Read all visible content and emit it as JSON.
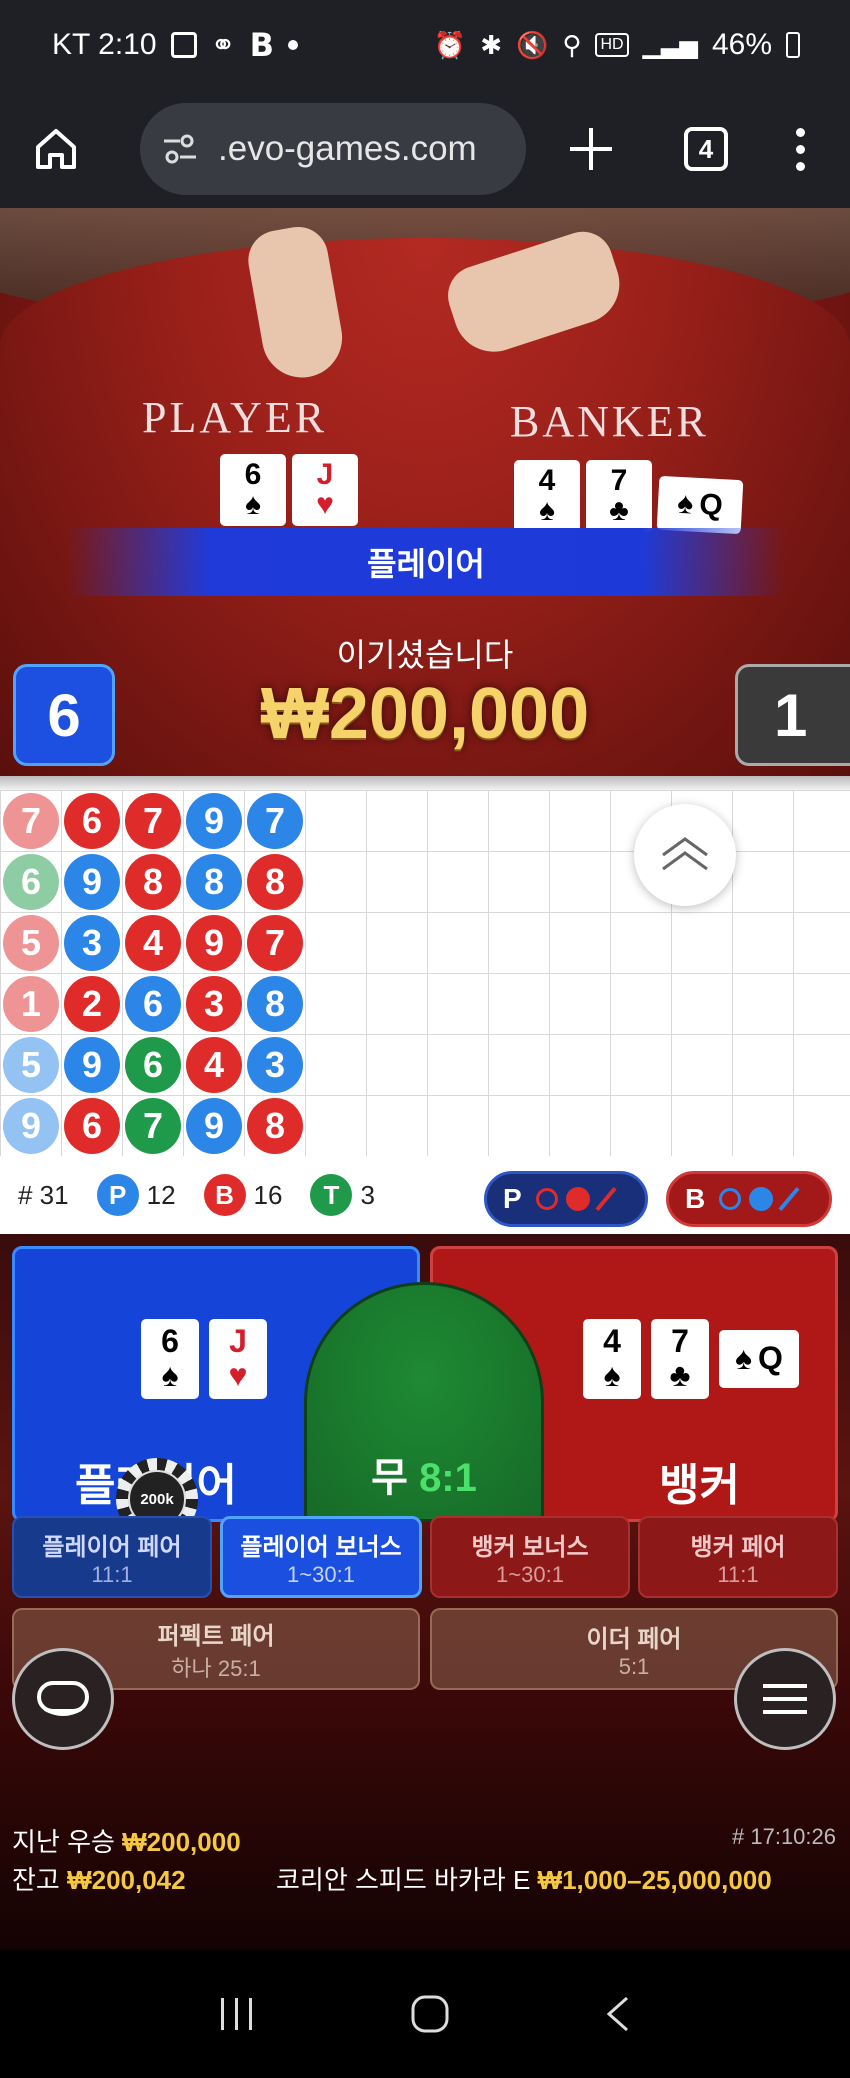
{
  "status_bar": {
    "carrier_time": "KT 2:10",
    "battery": "46%"
  },
  "browser": {
    "url": ".evo-games.com",
    "tab_count": "4"
  },
  "video": {
    "player_label": "PLAYER",
    "banker_label": "BANKER",
    "player_cards": [
      {
        "rank": "6",
        "suit": "♠",
        "color": "black"
      },
      {
        "rank": "J",
        "suit": "♥",
        "color": "red"
      }
    ],
    "banker_cards": [
      {
        "rank": "4",
        "suit": "♠",
        "color": "black"
      },
      {
        "rank": "7",
        "suit": "♣",
        "color": "black"
      },
      {
        "rank": "Q",
        "suit": "♠",
        "color": "black"
      }
    ],
    "winner_banner": "플레이어",
    "win_message": "이기셨습니다",
    "win_amount": "₩200,000",
    "player_score": "6",
    "banker_score": "1"
  },
  "bead_road": {
    "columns": [
      [
        {
          "v": "7",
          "t": "B",
          "faded": true
        },
        {
          "v": "6",
          "t": "T",
          "faded": true
        },
        {
          "v": "5",
          "t": "B",
          "faded": true
        },
        {
          "v": "1",
          "t": "B",
          "faded": true
        },
        {
          "v": "5",
          "t": "P",
          "faded": true
        },
        {
          "v": "9",
          "t": "P",
          "faded": true
        }
      ],
      [
        {
          "v": "6",
          "t": "B"
        },
        {
          "v": "9",
          "t": "P"
        },
        {
          "v": "3",
          "t": "P"
        },
        {
          "v": "2",
          "t": "B"
        },
        {
          "v": "9",
          "t": "P"
        },
        {
          "v": "6",
          "t": "B"
        }
      ],
      [
        {
          "v": "7",
          "t": "B"
        },
        {
          "v": "8",
          "t": "B"
        },
        {
          "v": "4",
          "t": "B"
        },
        {
          "v": "6",
          "t": "P"
        },
        {
          "v": "6",
          "t": "T"
        },
        {
          "v": "7",
          "t": "T"
        }
      ],
      [
        {
          "v": "9",
          "t": "P"
        },
        {
          "v": "8",
          "t": "P"
        },
        {
          "v": "9",
          "t": "B"
        },
        {
          "v": "3",
          "t": "B"
        },
        {
          "v": "4",
          "t": "B"
        },
        {
          "v": "9",
          "t": "P"
        }
      ],
      [
        {
          "v": "7",
          "t": "P"
        },
        {
          "v": "8",
          "t": "B"
        },
        {
          "v": "7",
          "t": "B"
        },
        {
          "v": "8",
          "t": "P"
        },
        {
          "v": "3",
          "t": "P"
        },
        {
          "v": "8",
          "t": "B"
        }
      ]
    ]
  },
  "stats": {
    "rounds_label": "# 31",
    "player_badge": "P",
    "player_count": "12",
    "banker_badge": "B",
    "banker_count": "16",
    "tie_badge": "T",
    "tie_count": "3",
    "predict_player": "P",
    "predict_banker": "B"
  },
  "bets": {
    "player": "플레이어",
    "tie": "무",
    "tie_odds": "8:1",
    "banker": "뱅커",
    "chip_value": "200k",
    "side": [
      {
        "label": "플레이어 페어",
        "odds": "11:1"
      },
      {
        "label": "플레이어 보너스",
        "odds": "1~30:1"
      },
      {
        "label": "뱅커 보너스",
        "odds": "1~30:1"
      },
      {
        "label": "뱅커 페어",
        "odds": "11:1"
      }
    ],
    "perfect_pair": {
      "label": "퍼펙트 페어",
      "odds": "하나 25:1"
    },
    "either_pair": {
      "label": "이더 페어",
      "odds": "5:1"
    }
  },
  "footer": {
    "last_win_label": "지난 우승",
    "last_win_value": "₩200,000",
    "time": "# 17:10:26",
    "balance_label": "잔고",
    "balance_value": "₩200,042",
    "table_name": "코리안 스피드 바카라 E",
    "limits": "₩1,000–25,000,000"
  },
  "colors": {
    "player_blue": "#1445d8",
    "banker_red": "#b01818",
    "tie_green": "#1e8a34",
    "gold": "#f5c842"
  }
}
